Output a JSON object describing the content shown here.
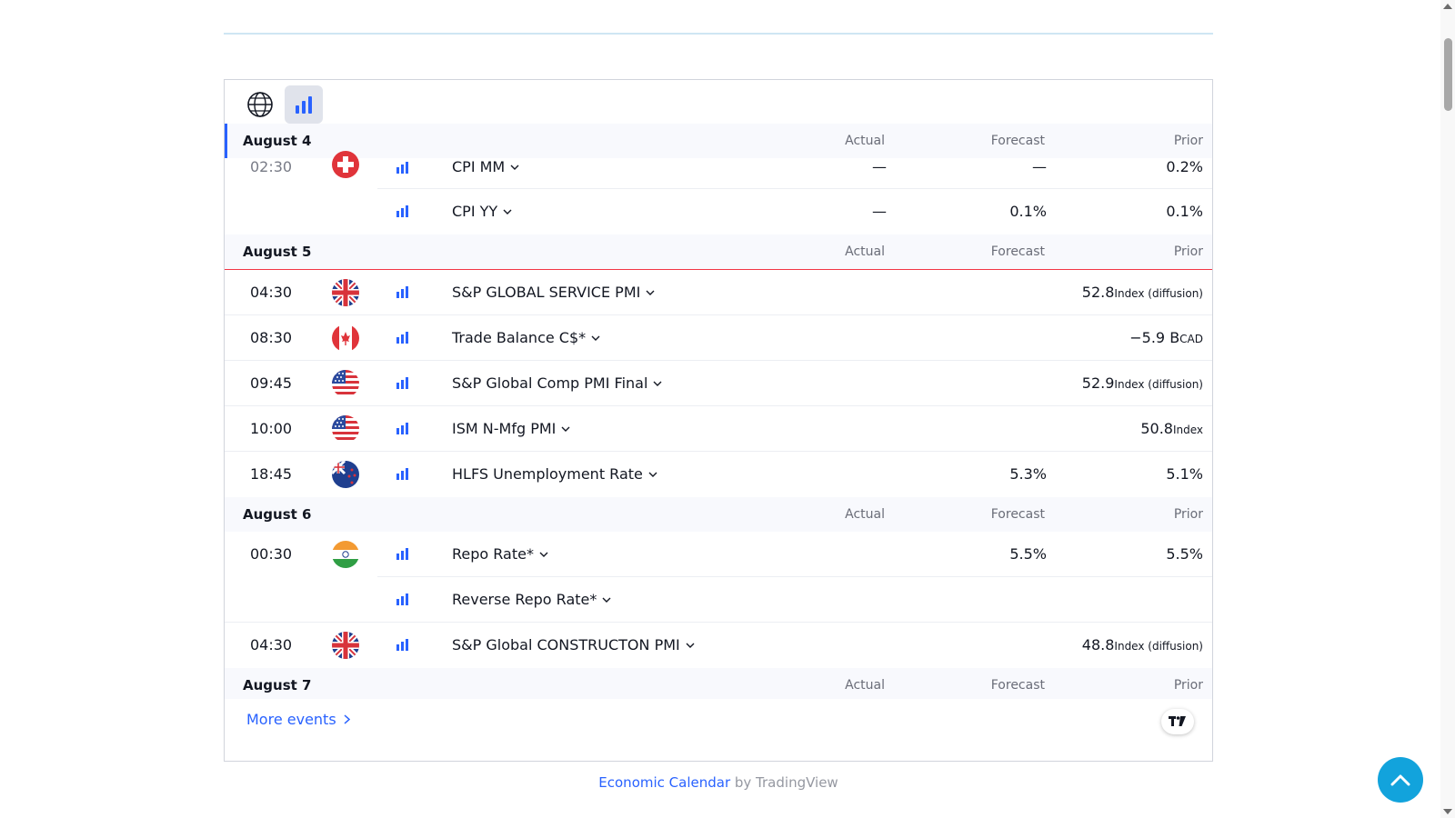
{
  "colors": {
    "accent": "#2962ff",
    "importance": "#2962ff",
    "scroll_top_button": "#12a3dc",
    "today_line": "#f23645"
  },
  "toolbar": {
    "globe_icon": "globe-icon",
    "importance_icon": "bar-chart-icon"
  },
  "columns": {
    "actual": "Actual",
    "forecast": "Forecast",
    "prior": "Prior"
  },
  "days": [
    {
      "date": "August 4",
      "events": [
        {
          "time": "02:30",
          "country": "switzerland-flag",
          "title": "CPI MM",
          "actual": "—",
          "forecast": "—",
          "prior": "0.2%",
          "prior_unit": ""
        },
        {
          "time": "",
          "country": "",
          "title": "CPI YY",
          "actual": "—",
          "forecast": "0.1%",
          "prior": "0.1%",
          "prior_unit": ""
        }
      ]
    },
    {
      "date": "August 5",
      "events": [
        {
          "time": "04:30",
          "country": "uk-flag",
          "title": "S&P GLOBAL SERVICE PMI",
          "actual": "",
          "forecast": "",
          "prior": "52.8",
          "prior_unit": "Index (diffusion)"
        },
        {
          "time": "08:30",
          "country": "canada-flag",
          "title": "Trade Balance C$*",
          "actual": "",
          "forecast": "",
          "prior": "−5.9 B",
          "prior_unit": "CAD"
        },
        {
          "time": "09:45",
          "country": "usa-flag",
          "title": "S&P Global Comp PMI Final",
          "actual": "",
          "forecast": "",
          "prior": "52.9",
          "prior_unit": "Index (diffusion)"
        },
        {
          "time": "10:00",
          "country": "usa-flag",
          "title": "ISM N-Mfg PMI",
          "actual": "",
          "forecast": "",
          "prior": "50.8",
          "prior_unit": "Index"
        },
        {
          "time": "18:45",
          "country": "new-zealand-flag",
          "title": "HLFS Unemployment Rate",
          "actual": "",
          "forecast": "5.3%",
          "prior": "5.1%",
          "prior_unit": ""
        }
      ]
    },
    {
      "date": "August 6",
      "events": [
        {
          "time": "00:30",
          "country": "india-flag",
          "title": "Repo Rate*",
          "actual": "",
          "forecast": "5.5%",
          "prior": "5.5%",
          "prior_unit": ""
        },
        {
          "time": "",
          "country": "",
          "title": "Reverse Repo Rate*",
          "actual": "",
          "forecast": "",
          "prior": "",
          "prior_unit": ""
        },
        {
          "time": "04:30",
          "country": "uk-flag",
          "title": "S&P Global CONSTRUCTON PMI",
          "actual": "",
          "forecast": "",
          "prior": "48.8",
          "prior_unit": "Index (diffusion)"
        }
      ]
    },
    {
      "date": "August 7",
      "events": []
    }
  ],
  "more_events": "More events",
  "footer": {
    "link": "Economic Calendar",
    "suffix": " by TradingView"
  }
}
